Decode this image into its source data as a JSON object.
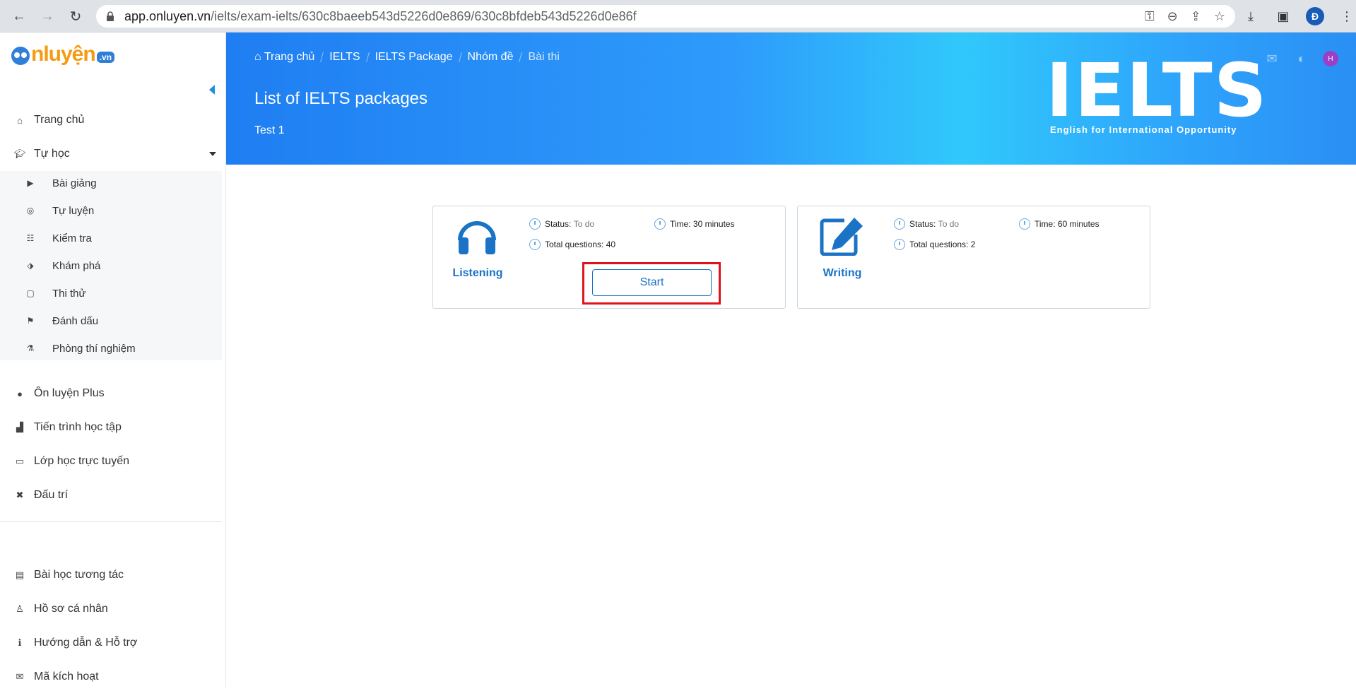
{
  "browser": {
    "url_host": "app.onluyen.vn",
    "url_path": "/ielts/exam-ielts/630c8baeeb543d5226d0e869/630c8bfdeb543d5226d0e86f",
    "profile_initial": "Đ"
  },
  "logo": {
    "text": "nluyện",
    "tld": ".vn"
  },
  "sidebar": {
    "items": [
      {
        "label": "Trang chủ",
        "icon": "home-icon"
      },
      {
        "label": "Tự học",
        "icon": "graduation-cap-icon"
      }
    ],
    "subitems": [
      {
        "label": "Bài giảng",
        "icon": "video-icon"
      },
      {
        "label": "Tự luyện",
        "icon": "target-icon"
      },
      {
        "label": "Kiểm tra",
        "icon": "checklist-icon"
      },
      {
        "label": "Khám phá",
        "icon": "explore-icon"
      },
      {
        "label": "Thi thử",
        "icon": "clipboard-icon"
      },
      {
        "label": "Đánh dấu",
        "icon": "bookmark-icon"
      },
      {
        "label": "Phòng thí nghiệm",
        "icon": "lab-icon"
      }
    ],
    "items2": [
      {
        "label": "Ôn luyện Plus",
        "icon": "plus-badge-icon"
      },
      {
        "label": "Tiến trình học tập",
        "icon": "bar-chart-icon"
      },
      {
        "label": "Lớp học trực tuyến",
        "icon": "monitor-icon"
      },
      {
        "label": "Đấu trí",
        "icon": "battle-icon"
      }
    ],
    "bottom": [
      {
        "label": "Bài học tương tác",
        "icon": "interactive-icon"
      },
      {
        "label": "Hồ sơ cá nhân",
        "icon": "user-icon"
      },
      {
        "label": "Hướng dẫn & Hỗ trợ",
        "icon": "help-icon"
      },
      {
        "label": "Mã kích hoạt",
        "icon": "envelope-icon"
      }
    ]
  },
  "header": {
    "breadcrumb": [
      "Trang chủ",
      "IELTS",
      "IELTS Package",
      "Nhóm đề",
      "Bài thi"
    ],
    "title": "List of IELTS packages",
    "subtitle": "Test 1",
    "brand": "IELTS",
    "brand_tag": "English for International Opportunity",
    "user_initial": "H"
  },
  "cards": [
    {
      "skill": "Listening",
      "icon": "headphones-icon",
      "status_label": "Status:",
      "status_value": "To do",
      "time_label": "Time:",
      "time_value": "30 minutes",
      "questions_label": "Total questions:",
      "questions_value": "40",
      "button": "Start"
    },
    {
      "skill": "Writing",
      "icon": "edit-icon",
      "status_label": "Status:",
      "status_value": "To do",
      "time_label": "Time:",
      "time_value": "60 minutes",
      "questions_label": "Total questions:",
      "questions_value": "2"
    }
  ],
  "colors": {
    "accent": "#1b73c6",
    "highlight": "#e0121a",
    "banner_start": "#1f7ef2",
    "banner_mid": "#30c8fb"
  }
}
